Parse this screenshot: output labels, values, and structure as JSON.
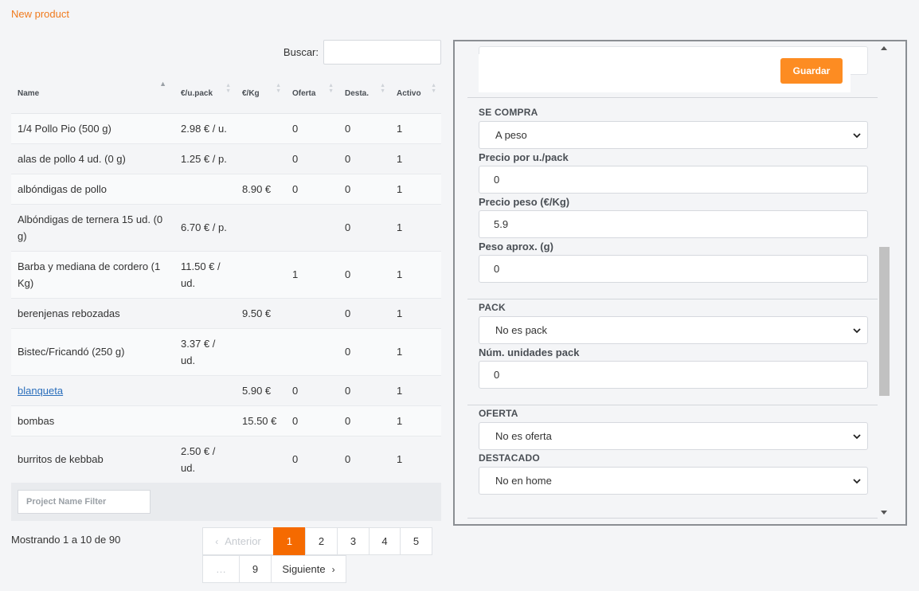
{
  "header": {
    "new_product_link": "New product"
  },
  "search": {
    "label": "Buscar:",
    "value": ""
  },
  "table": {
    "columns": [
      "Name",
      "€/u.pack",
      "€/Kg",
      "Oferta",
      "Desta.",
      "Activo"
    ],
    "rows": [
      {
        "name": "1/4 Pollo Pio (500 g)",
        "upack": "2.98 € / u.",
        "kg": "",
        "oferta": "0",
        "desta": "0",
        "activo": "1"
      },
      {
        "name": "alas de pollo 4 ud. (0 g)",
        "upack": "1.25 € / p.",
        "kg": "",
        "oferta": "0",
        "desta": "0",
        "activo": "1"
      },
      {
        "name": "albóndigas de pollo",
        "upack": "",
        "kg": "8.90 €",
        "oferta": "0",
        "desta": "0",
        "activo": "1"
      },
      {
        "name": "Albóndigas de ternera 15 ud. (0 g)",
        "upack": "6.70 € / p.",
        "kg": "",
        "oferta": "",
        "desta": "0",
        "activo": "1"
      },
      {
        "name": "Barba y mediana de cordero (1 Kg)",
        "upack": "11.50 € / ud.",
        "kg": "",
        "oferta": "1",
        "desta": "0",
        "activo": "1"
      },
      {
        "name": "berenjenas rebozadas",
        "upack": "",
        "kg": "9.50 €",
        "oferta": "",
        "desta": "0",
        "activo": "1"
      },
      {
        "name": "Bistec/Fricandó (250 g)",
        "upack": "3.37 € / ud.",
        "kg": "",
        "oferta": "",
        "desta": "0",
        "activo": "1"
      },
      {
        "name": "blanqueta",
        "upack": "",
        "kg": "5.90 €",
        "oferta": "0",
        "desta": "0",
        "activo": "1"
      },
      {
        "name": "bombas",
        "upack": "",
        "kg": "15.50 €",
        "oferta": "0",
        "desta": "0",
        "activo": "1"
      },
      {
        "name": "burritos de kebbab",
        "upack": "2.50 € / ud.",
        "kg": "",
        "oferta": "0",
        "desta": "0",
        "activo": "1"
      }
    ]
  },
  "filter": {
    "placeholder": "Project Name Filter"
  },
  "pagination": {
    "info": "Mostrando 1 a 10 de 90",
    "prev": "Anterior",
    "next": "Siguiente",
    "ellipsis": "…",
    "pages": [
      "1",
      "2",
      "3",
      "4",
      "5",
      "9"
    ],
    "current": "1"
  },
  "form": {
    "save_label": "Guardar",
    "se_compra": {
      "section": "SE COMPRA",
      "value": "A peso"
    },
    "precio_upack": {
      "label": "Precio por u./pack",
      "value": "0"
    },
    "precio_peso": {
      "label": "Precio peso (€/Kg)",
      "value": "5.9"
    },
    "peso_aprox": {
      "label": "Peso aprox. (g)",
      "value": "0"
    },
    "pack": {
      "section": "PACK",
      "value": "No es pack"
    },
    "num_unidades": {
      "label": "Núm. unidades pack",
      "value": "0"
    },
    "oferta": {
      "section": "OFERTA",
      "value": "No es oferta"
    },
    "destacado": {
      "section": "DESTACADO",
      "value": "No en home"
    }
  },
  "colors": {
    "accent": "#f07a1d",
    "active_page": "#f56a00",
    "save_button": "#fd8c22",
    "visited_link": "#2a6ebb"
  }
}
